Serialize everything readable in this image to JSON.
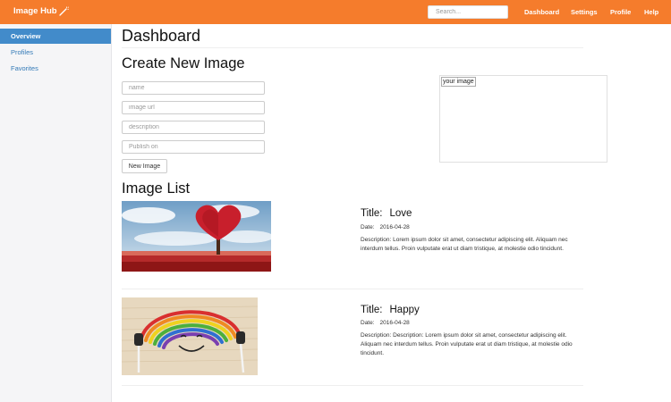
{
  "brand": {
    "name": "Image Hub",
    "icon": "magic-wand-icon"
  },
  "search": {
    "placeholder": "Search..."
  },
  "nav": [
    "Dashboard",
    "Settings",
    "Profile",
    "Help"
  ],
  "sidebar": {
    "items": [
      {
        "label": "Overview",
        "active": true
      },
      {
        "label": "Profiles",
        "active": false
      },
      {
        "label": "Favorites",
        "active": false
      }
    ]
  },
  "page_title": "Dashboard",
  "create": {
    "heading": "Create New Image",
    "fields": [
      {
        "placeholder": "name"
      },
      {
        "placeholder": "image url"
      },
      {
        "placeholder": "description"
      },
      {
        "placeholder": "Publish on"
      }
    ],
    "button": "New Image",
    "preview_label": "your image"
  },
  "list": {
    "heading": "Image List",
    "items": [
      {
        "title_label": "Title:",
        "title": "Love",
        "date_label": "Date:",
        "date": "2016-04-28",
        "description": "Description:   Lorem ipsum dolor sit amet, consectetur adipiscing elit. Aliquam nec interdum tellus. Proin vulputate erat ut diam tristique, at molestie odio tincidunt.",
        "image": "heart-tree-photo"
      },
      {
        "title_label": "Title:",
        "title": "Happy",
        "date_label": "Date:",
        "date": "2016-04-28",
        "description": "Description:   Description: Lorem ipsum dolor sit amet, consectetur adipiscing elit. Aliquam nec interdum tellus. Proin vulputate erat ut diam tristique, at molestie odio tincidunt.",
        "image": "rainbow-smile-photo"
      }
    ]
  },
  "colors": {
    "navbar": "#f57c2c",
    "sidebar_active": "#428bca",
    "link": "#337ab7"
  }
}
